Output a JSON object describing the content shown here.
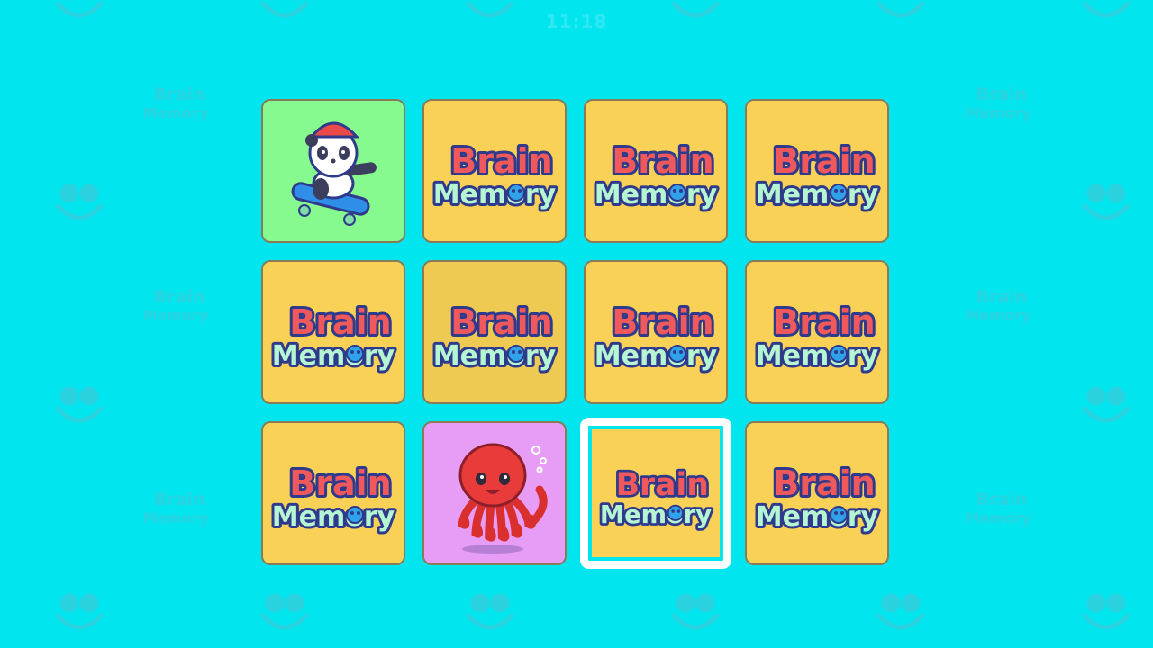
{
  "game": {
    "timer": "11:18",
    "logo_word_1": "Brain",
    "logo_word_2": "Memory",
    "colors": {
      "background": "#00e5ee",
      "pattern": "#2ad2e0",
      "card_back": "#f9d157",
      "card_back_dim": "#efca52",
      "card_border": "#8a7a55",
      "panda_card": "#86fa8e",
      "octopus_card": "#e79df5",
      "logo_red": "#f0595b",
      "logo_mint": "#b6f5d2",
      "logo_blue": "#30a2e9",
      "logo_outline": "#2f3a8c",
      "selection_frame": "#ffffff"
    }
  },
  "cards": [
    {
      "face": "panda-skateboard-icon",
      "state": "revealed",
      "selected": false,
      "dimmed": false
    },
    {
      "face": "brain-memory-logo",
      "state": "hidden",
      "selected": false,
      "dimmed": false
    },
    {
      "face": "brain-memory-logo",
      "state": "hidden",
      "selected": false,
      "dimmed": false
    },
    {
      "face": "brain-memory-logo",
      "state": "hidden",
      "selected": false,
      "dimmed": false
    },
    {
      "face": "brain-memory-logo",
      "state": "hidden",
      "selected": false,
      "dimmed": false
    },
    {
      "face": "brain-memory-logo",
      "state": "hidden",
      "selected": false,
      "dimmed": true
    },
    {
      "face": "brain-memory-logo",
      "state": "hidden",
      "selected": false,
      "dimmed": false
    },
    {
      "face": "brain-memory-logo",
      "state": "hidden",
      "selected": false,
      "dimmed": false
    },
    {
      "face": "brain-memory-logo",
      "state": "hidden",
      "selected": false,
      "dimmed": false
    },
    {
      "face": "octopus-icon",
      "state": "revealed",
      "selected": false,
      "dimmed": false
    },
    {
      "face": "brain-memory-logo",
      "state": "hidden",
      "selected": true,
      "dimmed": false
    },
    {
      "face": "brain-memory-logo",
      "state": "hidden",
      "selected": false,
      "dimmed": false
    }
  ]
}
